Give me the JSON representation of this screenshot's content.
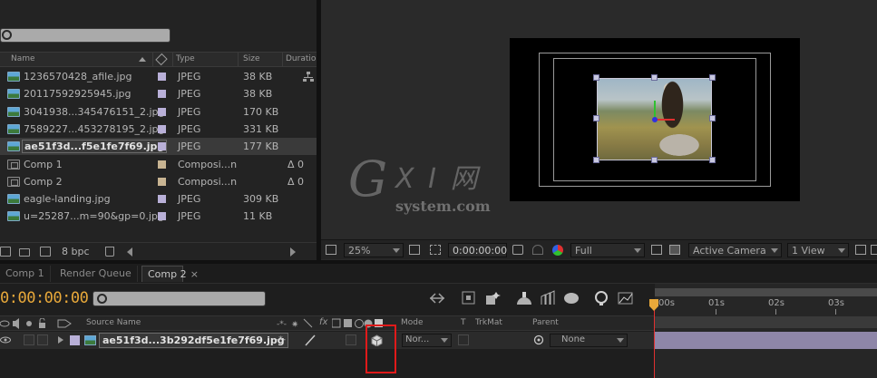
{
  "project": {
    "search_placeholder": "",
    "columns": {
      "name": "Name",
      "type": "Type",
      "size": "Size",
      "duration": "Duration"
    },
    "items": [
      {
        "name": "1236570428_afile.jpg",
        "type": "JPEG",
        "size": "38 KB",
        "duration": "",
        "kind": "image",
        "label_color": "#b9b0d8"
      },
      {
        "name": "20117592925945.jpg",
        "type": "JPEG",
        "size": "38 KB",
        "duration": "",
        "kind": "image",
        "label_color": "#b9b0d8"
      },
      {
        "name": "3041938...345476151_2.jpg",
        "type": "JPEG",
        "size": "170 KB",
        "duration": "",
        "kind": "image",
        "label_color": "#b9b0d8"
      },
      {
        "name": "7589227...453278195_2.jpg",
        "type": "JPEG",
        "size": "331 KB",
        "duration": "",
        "kind": "image",
        "label_color": "#b9b0d8"
      },
      {
        "name": "ae51f3d...f5e1fe7f69.jpg",
        "type": "JPEG",
        "size": "177 KB",
        "duration": "",
        "kind": "image",
        "label_color": "#b9b0d8",
        "selected": true
      },
      {
        "name": "Comp 1",
        "type": "Composi...n",
        "size": "",
        "duration": "Δ 0",
        "kind": "comp",
        "label_color": "#c8b492"
      },
      {
        "name": "Comp 2",
        "type": "Composi...n",
        "size": "",
        "duration": "Δ 0",
        "kind": "comp",
        "label_color": "#c8b492"
      },
      {
        "name": "eagle-landing.jpg",
        "type": "JPEG",
        "size": "309 KB",
        "duration": "",
        "kind": "image",
        "label_color": "#b9b0d8"
      },
      {
        "name": "u=25287...m=90&gp=0.jpg",
        "type": "JPEG",
        "size": "11 KB",
        "duration": "",
        "kind": "image",
        "label_color": "#b9b0d8"
      }
    ],
    "footer": {
      "bpc": "8 bpc"
    }
  },
  "viewer": {
    "zoom": "25%",
    "timecode": "0:00:00:00",
    "resolution": "Full",
    "camera": "Active Camera",
    "views": "1 View"
  },
  "watermark": {
    "g": "G",
    "xi": "X I 网",
    "site": "system.com"
  },
  "timeline": {
    "tabs": [
      {
        "label": "Comp 1",
        "active": false
      },
      {
        "label": "Render Queue",
        "active": false
      },
      {
        "label": "Comp 2",
        "active": true
      }
    ],
    "close_glyph": "×",
    "current_time": "0:00:00:00",
    "columns": {
      "source_name": "Source Name",
      "mode": "Mode",
      "t": "T",
      "trkmat": "TrkMat",
      "parent": "Parent",
      "switches": "fx"
    },
    "layer": {
      "name": "ae51f3d...3b292df5e1fe7f69.jpg",
      "mode": "Nor...",
      "parent": "None"
    },
    "ruler": [
      "00s",
      "01s",
      "02s",
      "03s"
    ],
    "accent_color": "#e9a93a",
    "highlight_color": "#e01a1a"
  }
}
